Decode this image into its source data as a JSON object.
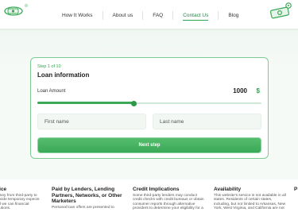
{
  "nav": {
    "items": [
      {
        "label": "How It Works"
      },
      {
        "label": "About us"
      },
      {
        "label": "FAQ"
      },
      {
        "label": "Contact Us",
        "active": true
      },
      {
        "label": "Blog"
      }
    ]
  },
  "colors": {
    "accent": "#2ea54e",
    "button": "#3aa957",
    "border": "#7ccc92"
  },
  "form": {
    "step": "Step 1 of 10",
    "title": "Loan information",
    "amount_label": "Loan Amount",
    "amount_value": "1000",
    "currency": "$",
    "slider_fraction": 0.43,
    "first_name_placeholder": "First name",
    "last_name_placeholder": "Last name",
    "next_label": "Next step"
  },
  "footer": {
    "columns": [
      {
        "title": "otice",
        "text": "money from third-party to provide temporary expects and we can financial solutions."
      },
      {
        "title": "Paid by Lenders, Lending Partners, Networks, or Other Marketers",
        "text": "Personal loan offers are presented to"
      },
      {
        "title": "Credit Implications",
        "text": "Some third-party lenders may conduct credit checks with credit bureaus or obtain consumer reports through alternative providers to determine your eligibility for a"
      },
      {
        "title": "Availability",
        "text": "This website's service is not available in all states. Residents of certain states, including, but not limited to Arkansas, New York, West Virginia, and California are not"
      },
      {
        "title": "P",
        "text": ""
      }
    ]
  }
}
